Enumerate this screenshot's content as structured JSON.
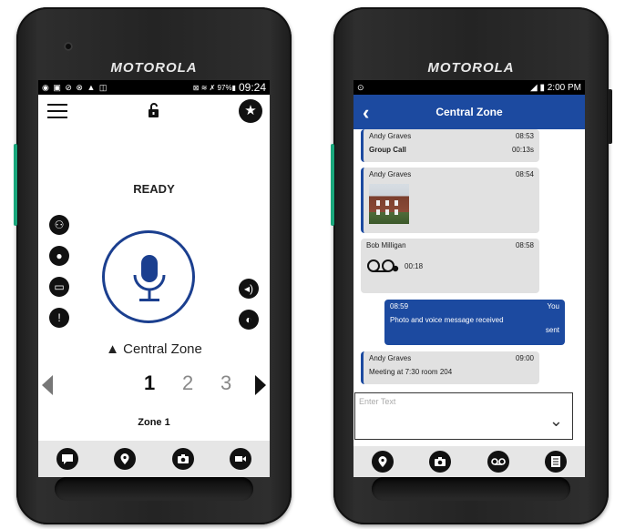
{
  "left": {
    "brand": "MOTOROLA",
    "status": {
      "icons": "◉ ▣ ⊘ ⊗ ▲ ◫",
      "right_icons": "⊠ ≋ ✗ 97%▮",
      "time": "09:24"
    },
    "ready_text": "READY",
    "zone_name": "Central Zone",
    "zone_numbers": [
      "1",
      "2",
      "3"
    ],
    "selected_zone": "1",
    "zone_label": "Zone 1",
    "left_icons": [
      "people-group-icon",
      "person-icon",
      "folder-icon",
      "alert-icon"
    ],
    "right_icons": [
      "volume-icon",
      "speaker-mode-icon"
    ],
    "bottom_nav": [
      "chat-icon",
      "location-icon",
      "camera-icon",
      "video-icon"
    ]
  },
  "right": {
    "brand": "MOTOROLA",
    "status": {
      "left": "⊙",
      "right": "◢ ▮ 2:00 PM"
    },
    "header_title": "Central Zone",
    "messages": [
      {
        "sender": "Andy Graves",
        "time": "08:53",
        "body": "Group Call",
        "duration": "00:13s"
      },
      {
        "sender": "Andy Graves",
        "time": "08:54"
      },
      {
        "sender": "Bob Milligan",
        "time": "08:58",
        "duration": "00:18"
      },
      {
        "time": "08:59",
        "sender": "You",
        "body": "Photo and voice message received",
        "status": "sent"
      },
      {
        "sender": "Andy Graves",
        "time": "09:00",
        "body": "Meeting at 7:30 room 204"
      }
    ],
    "input_placeholder": "Enter Text",
    "bottom_nav": [
      "location-icon",
      "camera-icon",
      "voicemail-icon",
      "document-icon"
    ],
    "colors": {
      "accent": "#1c4aa0"
    }
  }
}
